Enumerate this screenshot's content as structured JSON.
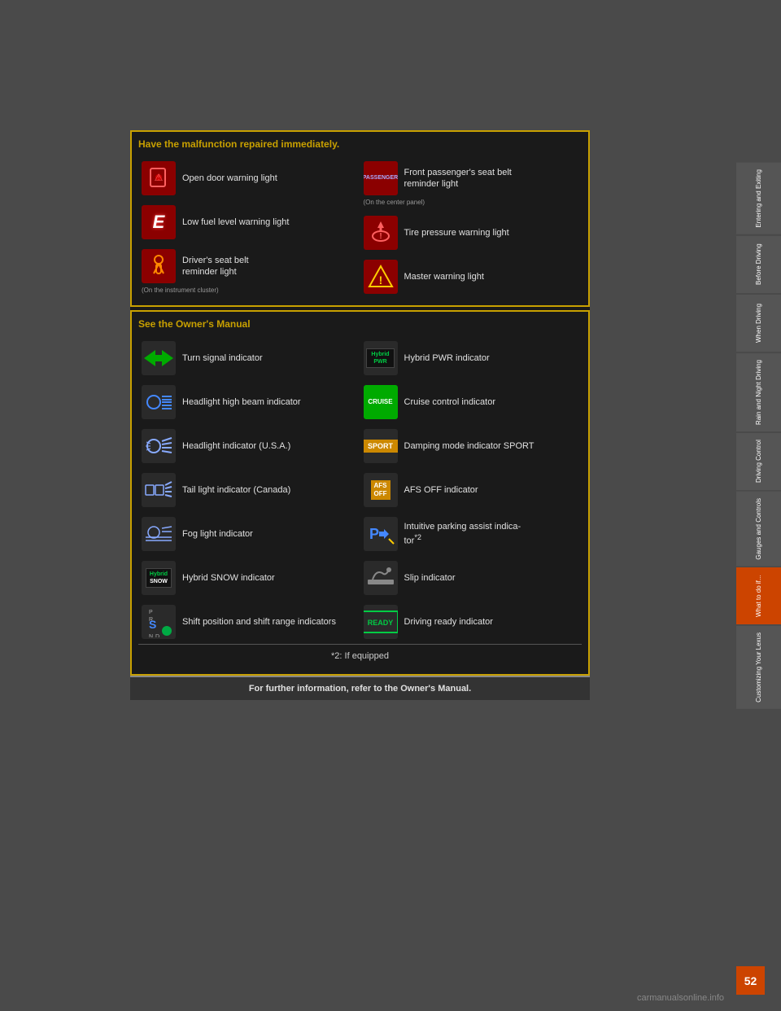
{
  "page": {
    "number": "52",
    "watermark": "carmanualsonline.info"
  },
  "sidebar": {
    "tabs": [
      {
        "label": "Entering and Exiting",
        "active": false
      },
      {
        "label": "Before Driving",
        "active": false
      },
      {
        "label": "When Driving",
        "active": false
      },
      {
        "label": "Rain and Night Driving",
        "active": false
      },
      {
        "label": "Driving Control",
        "active": false
      },
      {
        "label": "Gauges and Controls",
        "active": false
      },
      {
        "label": "What to do if...",
        "active": true
      },
      {
        "label": "Customizing Your Lexus",
        "active": false
      }
    ]
  },
  "malfunction_section": {
    "header": "Have the malfunction repaired immediately.",
    "items_left": [
      {
        "icon": "open-door",
        "text": "Open door warning light"
      },
      {
        "icon": "fuel-e",
        "text": "Low fuel level warning light"
      },
      {
        "icon": "seatbelt-driver",
        "text": "Driver's seat belt reminder light",
        "note": "(On the instrument cluster)"
      }
    ],
    "items_right": [
      {
        "icon": "passenger-seat",
        "text": "Front passenger's seat belt reminder light",
        "note": "(On the center panel)"
      },
      {
        "icon": "tire-pressure",
        "text": "Tire pressure warning light"
      },
      {
        "icon": "master-warning",
        "text": "Master warning light"
      }
    ]
  },
  "see_manual_section": {
    "header": "See the Owner's Manual",
    "items_left": [
      {
        "icon": "turn-signal",
        "text": "Turn signal indicator"
      },
      {
        "icon": "headlight-high",
        "text": "Headlight high beam indicator"
      },
      {
        "icon": "headlight-usa",
        "text": "Headlight indicator (U.S.A.)"
      },
      {
        "icon": "tail-light",
        "text": "Tail light indicator (Canada)"
      },
      {
        "icon": "fog-light",
        "text": "Fog light indicator"
      },
      {
        "icon": "hybrid-snow",
        "text": "Hybrid SNOW indicator"
      },
      {
        "icon": "shift-position",
        "text": "Shift position and shift range indicators"
      }
    ],
    "items_right": [
      {
        "icon": "hybrid-pwr",
        "text": "Hybrid PWR indicator"
      },
      {
        "icon": "cruise",
        "text": "Cruise control indicator"
      },
      {
        "icon": "sport",
        "text": "Damping mode indicator SPORT"
      },
      {
        "icon": "afs-off",
        "text": "AFS OFF indicator"
      },
      {
        "icon": "parking-assist",
        "text": "Intuitive parking assist indicator*2"
      },
      {
        "icon": "slip",
        "text": "Slip indicator"
      },
      {
        "icon": "ready",
        "text": "Driving ready indicator"
      }
    ]
  },
  "footnote": "*2: If equipped",
  "footer": "For further information, refer to the Owner's Manual."
}
